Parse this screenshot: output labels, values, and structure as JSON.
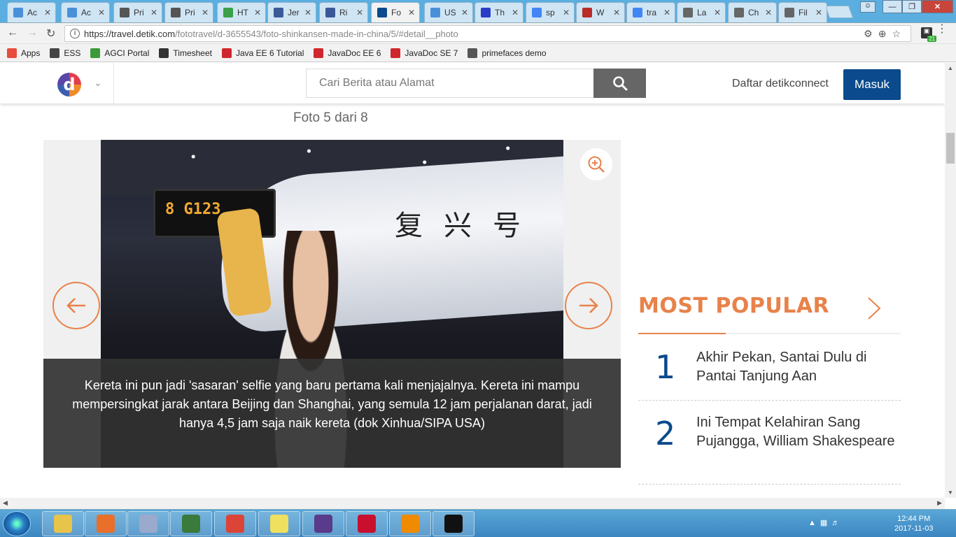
{
  "browser": {
    "tabs": [
      {
        "label": "Ac",
        "icon": "doc-icon",
        "color": "#4a90d9"
      },
      {
        "label": "Ac",
        "icon": "doc-icon",
        "color": "#4a90d9"
      },
      {
        "label": "Pri",
        "icon": "shield-icon",
        "color": "#555555"
      },
      {
        "label": "Pri",
        "icon": "shield-icon",
        "color": "#555555"
      },
      {
        "label": "HT",
        "icon": "html-icon",
        "color": "#3aa04a"
      },
      {
        "label": "Jer",
        "icon": "facebook-icon",
        "color": "#3b5998"
      },
      {
        "label": "Ri",
        "icon": "facebook-icon",
        "color": "#3b5998"
      },
      {
        "label": "Fo",
        "icon": "detik-icon",
        "color": "#0b4a8c",
        "active": true
      },
      {
        "label": "US",
        "icon": "doc-icon",
        "color": "#4a90d9"
      },
      {
        "label": "Th",
        "icon": "b-icon",
        "color": "#2a3cc8"
      },
      {
        "label": "sp",
        "icon": "google-icon",
        "color": "#4285f4"
      },
      {
        "label": "W",
        "icon": "quora-icon",
        "color": "#b92b27"
      },
      {
        "label": "tra",
        "icon": "google-icon",
        "color": "#4285f4"
      },
      {
        "label": "La",
        "icon": "wikipedia-icon",
        "color": "#666666"
      },
      {
        "label": "Ch",
        "icon": "wikipedia-icon",
        "color": "#666666"
      },
      {
        "label": "Fil",
        "icon": "wikipedia-icon",
        "color": "#666666"
      }
    ],
    "url_host": "https://travel.detik.com",
    "url_path": "/fototravel/d-3655543/foto-shinkansen-made-in-china/5/#detail__photo",
    "extension_badge": "21",
    "bookmarks": [
      {
        "label": "Apps",
        "icon": "apps-grid-icon",
        "color": "#e84c3d"
      },
      {
        "label": "ESS",
        "icon": "ess-icon",
        "color": "#444444"
      },
      {
        "label": "AGCI Portal",
        "icon": "agci-icon",
        "color": "#3a9a3a"
      },
      {
        "label": "Timesheet",
        "icon": "timesheet-icon",
        "color": "#333333"
      },
      {
        "label": "Java EE 6 Tutorial",
        "icon": "oracle-icon",
        "color": "#d0262d"
      },
      {
        "label": "JavaDoc EE 6",
        "icon": "oracle-icon",
        "color": "#d0262d"
      },
      {
        "label": "JavaDoc SE 7",
        "icon": "oracle-icon",
        "color": "#d0262d"
      },
      {
        "label": "primefaces demo",
        "icon": "shield-icon",
        "color": "#555555"
      }
    ]
  },
  "site": {
    "logo_letter": "d",
    "search_placeholder": "Cari Berita atau Alamat",
    "daftar_label": "Daftar detikconnect",
    "masuk_label": "Masuk",
    "accent": "#e8824a",
    "brand": "#0b4a8c"
  },
  "gallery": {
    "counter": "Foto 5 dari 8",
    "sign_text": "8  G123",
    "sign_characters": "复兴号",
    "caption": "Kereta ini pun jadi 'sasaran' selfie yang baru pertama kali menjajalnya. Kereta ini mampu mempersingkat jarak antara Beijing dan Shanghai, yang semula 12 jam perjalanan darat, jadi hanya 4,5 jam saja naik kereta (dok Xinhua/SIPA USA)"
  },
  "most_popular": {
    "title": "MOST POPULAR",
    "items": [
      {
        "rank": "1",
        "title": "Akhir Pekan, Santai Dulu di Pantai Tanjung Aan"
      },
      {
        "rank": "2",
        "title": "Ini Tempat Kelahiran Sang Pujangga, William Shakespeare"
      }
    ]
  },
  "taskbar": {
    "apps": [
      {
        "name": "explorer-icon",
        "color": "#e8c44a"
      },
      {
        "name": "firefox-icon",
        "color": "#e8702a"
      },
      {
        "name": "notes-icon",
        "color": "#9ac"
      },
      {
        "name": "chart-app-icon",
        "color": "#3a7a3a"
      },
      {
        "name": "chrome-icon",
        "color": "#db4437"
      },
      {
        "name": "sticky-notes-icon",
        "color": "#f0e060"
      },
      {
        "name": "java-ee-ide-icon",
        "color": "#5a3a8a"
      },
      {
        "name": "acrobat-icon",
        "color": "#c8102e"
      },
      {
        "name": "vlc-icon",
        "color": "#f08a00"
      },
      {
        "name": "cmd-icon",
        "color": "#111111"
      }
    ],
    "time": "12:44 PM",
    "date": "2017-11-03"
  }
}
